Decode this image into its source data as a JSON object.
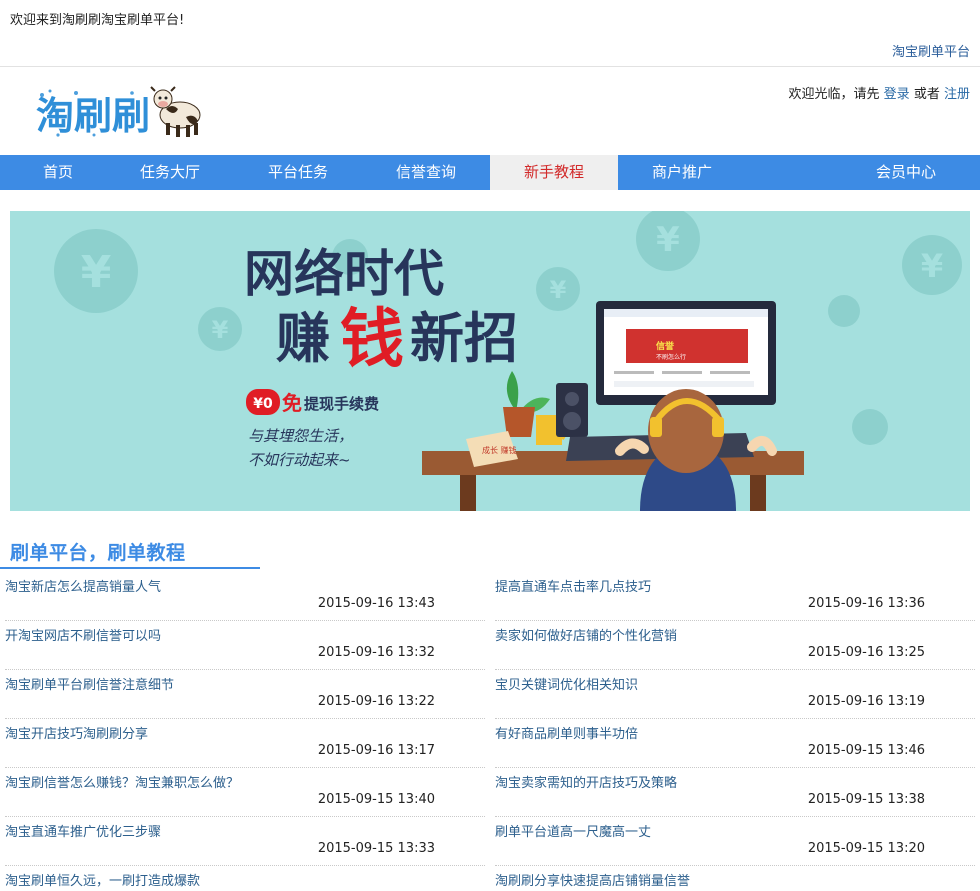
{
  "topbar": {
    "welcome": "欢迎来到淘刷刷淘宝刷单平台!",
    "right_link": "淘宝刷单平台"
  },
  "header": {
    "logo_text": "淘刷刷",
    "user_prefix": "欢迎光临，请先",
    "login": "登录",
    "or": "或者",
    "register": "注册"
  },
  "nav": {
    "items": [
      {
        "label": "首页"
      },
      {
        "label": "任务大厅"
      },
      {
        "label": "平台任务"
      },
      {
        "label": "信誉查询"
      },
      {
        "label": "新手教程",
        "active": true
      },
      {
        "label": "商户推广"
      },
      {
        "label": "会员中心"
      }
    ]
  },
  "banner": {
    "line1": "网络时代",
    "line2a": "赚",
    "line2b": "钱",
    "line2c": "新招",
    "fee_badge": "¥0",
    "fee_free": "免",
    "fee_text": "提现手续费",
    "slogan1": "与其埋怨生活，",
    "slogan2": "不如行动起来~",
    "screen_text1": "信誉",
    "screen_text2": "不刷怎么行",
    "note_text": "成长 赚钱"
  },
  "section": {
    "title": "刷单平台，刷单教程"
  },
  "articles_left": [
    {
      "title": "淘宝新店怎么提高销量人气",
      "date": "2015-09-16 13:43"
    },
    {
      "title": "开淘宝网店不刷信誉可以吗",
      "date": "2015-09-16 13:32"
    },
    {
      "title": "淘宝刷单平台刷信誉注意细节",
      "date": "2015-09-16 13:22"
    },
    {
      "title": "淘宝开店技巧淘刷刷分享",
      "date": "2015-09-16 13:17"
    },
    {
      "title": "淘宝刷信誉怎么赚钱？淘宝兼职怎么做？",
      "date": "2015-09-15 13:40"
    },
    {
      "title": "淘宝直通车推广优化三步骤",
      "date": "2015-09-15 13:33"
    },
    {
      "title": "淘宝刷单恒久远，一刷打造成爆款",
      "date": ""
    }
  ],
  "articles_right": [
    {
      "title": "提高直通车点击率几点技巧",
      "date": "2015-09-16 13:36"
    },
    {
      "title": "卖家如何做好店铺的个性化营销",
      "date": "2015-09-16 13:25"
    },
    {
      "title": "宝贝关键词优化相关知识",
      "date": "2015-09-16 13:19"
    },
    {
      "title": "有好商品刷单则事半功倍",
      "date": "2015-09-15 13:46"
    },
    {
      "title": "淘宝卖家需知的开店技巧及策略",
      "date": "2015-09-15 13:38"
    },
    {
      "title": "刷单平台道高一尺魔高一丈",
      "date": "2015-09-15 13:20"
    },
    {
      "title": "淘刷刷分享快速提高店铺销量信誉",
      "date": ""
    }
  ],
  "colors": {
    "nav_bg": "#3d8be4",
    "link": "#2c5f8d",
    "active_nav_text": "#d22a2a",
    "banner_bg": "#a5e0de"
  }
}
